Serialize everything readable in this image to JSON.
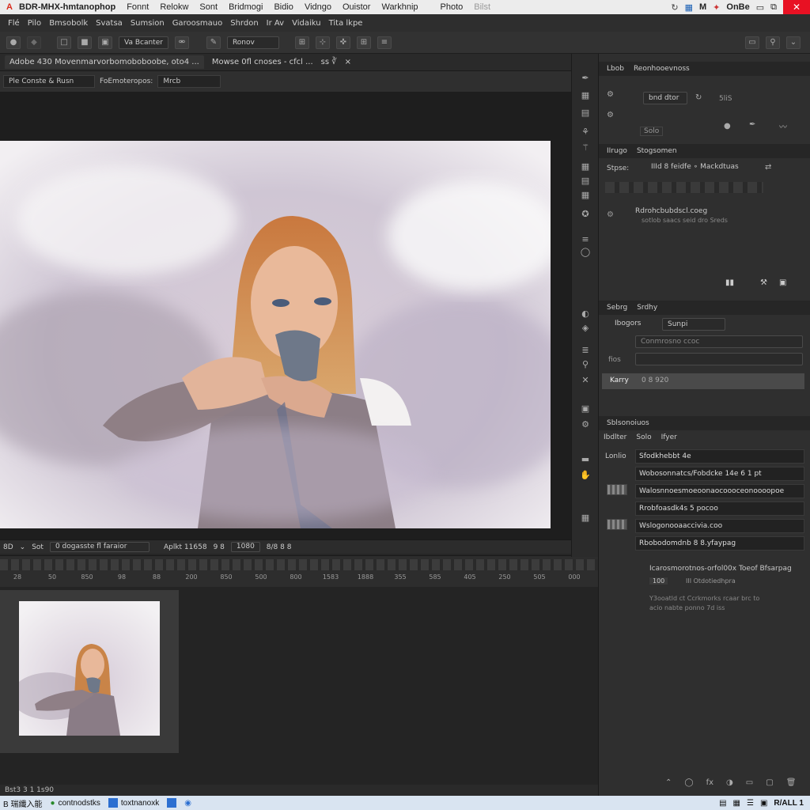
{
  "titlebar": {
    "logo": "A",
    "title": "BDR-MHX-hmtanophop",
    "menus": [
      "Fonnt",
      "Relokw",
      "Sont",
      "Bridmogi",
      "Bidio",
      "Vidngo",
      "Ouistor",
      "Warkhnip",
      "Photo",
      "Bilst"
    ],
    "right_label": "OnBe",
    "close": "✕"
  },
  "menubar": {
    "items": [
      "Flé",
      "Pilo",
      "Bmsobolk",
      "Svatsa",
      "Sumsion",
      "Garoosmauo",
      "Shrdon",
      "Ir Av",
      "Vidaiku",
      "Tita lkpe"
    ]
  },
  "optionsbar": {
    "field1": "Va Bcanter",
    "field2": "Ronov",
    "zoom": "✜"
  },
  "tabbar": {
    "tab1": "Adobe 430 Movenmarvorbomoboboobe, oto4 ...",
    "tab2": "Mowse 0fl cnoses - cfcl ...",
    "tab3": "ss ∛",
    "close": "×"
  },
  "subbar": {
    "sel1": "Ple Conste & Rusn",
    "label": "FoEmoteropos:",
    "sel2": "Mrcb"
  },
  "statusbar": {
    "a": "8D",
    "b": "Sot",
    "c": "0 dogasste fl faraior",
    "d": "Aplkt 11658",
    "e": "9 8",
    "f": "1080",
    "g": "8/8 8 8"
  },
  "ruler": [
    "28",
    "50",
    "850",
    "98",
    "88",
    "200",
    "850",
    "500",
    "800",
    "1583",
    "1888",
    "355",
    "585",
    "405",
    "250",
    "505",
    "000"
  ],
  "panels": {
    "top_tabs": [
      "Lbob",
      "Reonhooevnoss"
    ],
    "top_field": "bnd dtor",
    "top_label": "5liS",
    "top_small": "Solo",
    "second_tabs": [
      "IIrugo",
      "Stogsomen"
    ],
    "second_label": "Stpse:",
    "second_text": "IIId 8 feidfe ∘ Mackdtuas",
    "second_path": "Rdrohcbubdscl.coeg",
    "second_sub": "sotlob saacs seid dro Sreds",
    "third_tabs": [
      "Sebrg",
      "Srdhy"
    ],
    "third_sel1": "Ibogors",
    "third_sel2": "Sunpi",
    "third_field": "Conmrosno  ccoc",
    "third_field2": "fios",
    "third_karry": "Karry",
    "third_karry_val": "0 8 920",
    "layers_head": "Sblsonoiuos",
    "layers_tabs": [
      "Ibdlter",
      "Solo",
      "Ifyer"
    ],
    "layers_label": "Lonlio",
    "layers": [
      "Sfodkhebbt 4e",
      "Wobosonnatcs/Fobdcke 14e 6 1 pt",
      "Walosnnoesmoeoonaocoooceonoooopoe",
      "Rrobfoasdk4s 5 pocoo",
      "Wslogonooaaccivia.coo",
      "Rbobodomdnb 8 8.yfaypag"
    ],
    "info_line": "Icarosmorotnos-orfol00x   Toeof Bfsarpag",
    "info_tag": "100",
    "info_sub": "III  Otdotiedhpra",
    "info_para1": "Y3ooatld ct  Ccrkmorks rcaar brc to",
    "info_para2": "acio nabte ponno 7d iss"
  },
  "bottombar": "Bst3 3 1 1s90",
  "taskbar": {
    "items": [
      "B 瑞纖入能",
      "contnodstks",
      "toxtnanoxk"
    ],
    "clock": "R/ALL 1"
  }
}
